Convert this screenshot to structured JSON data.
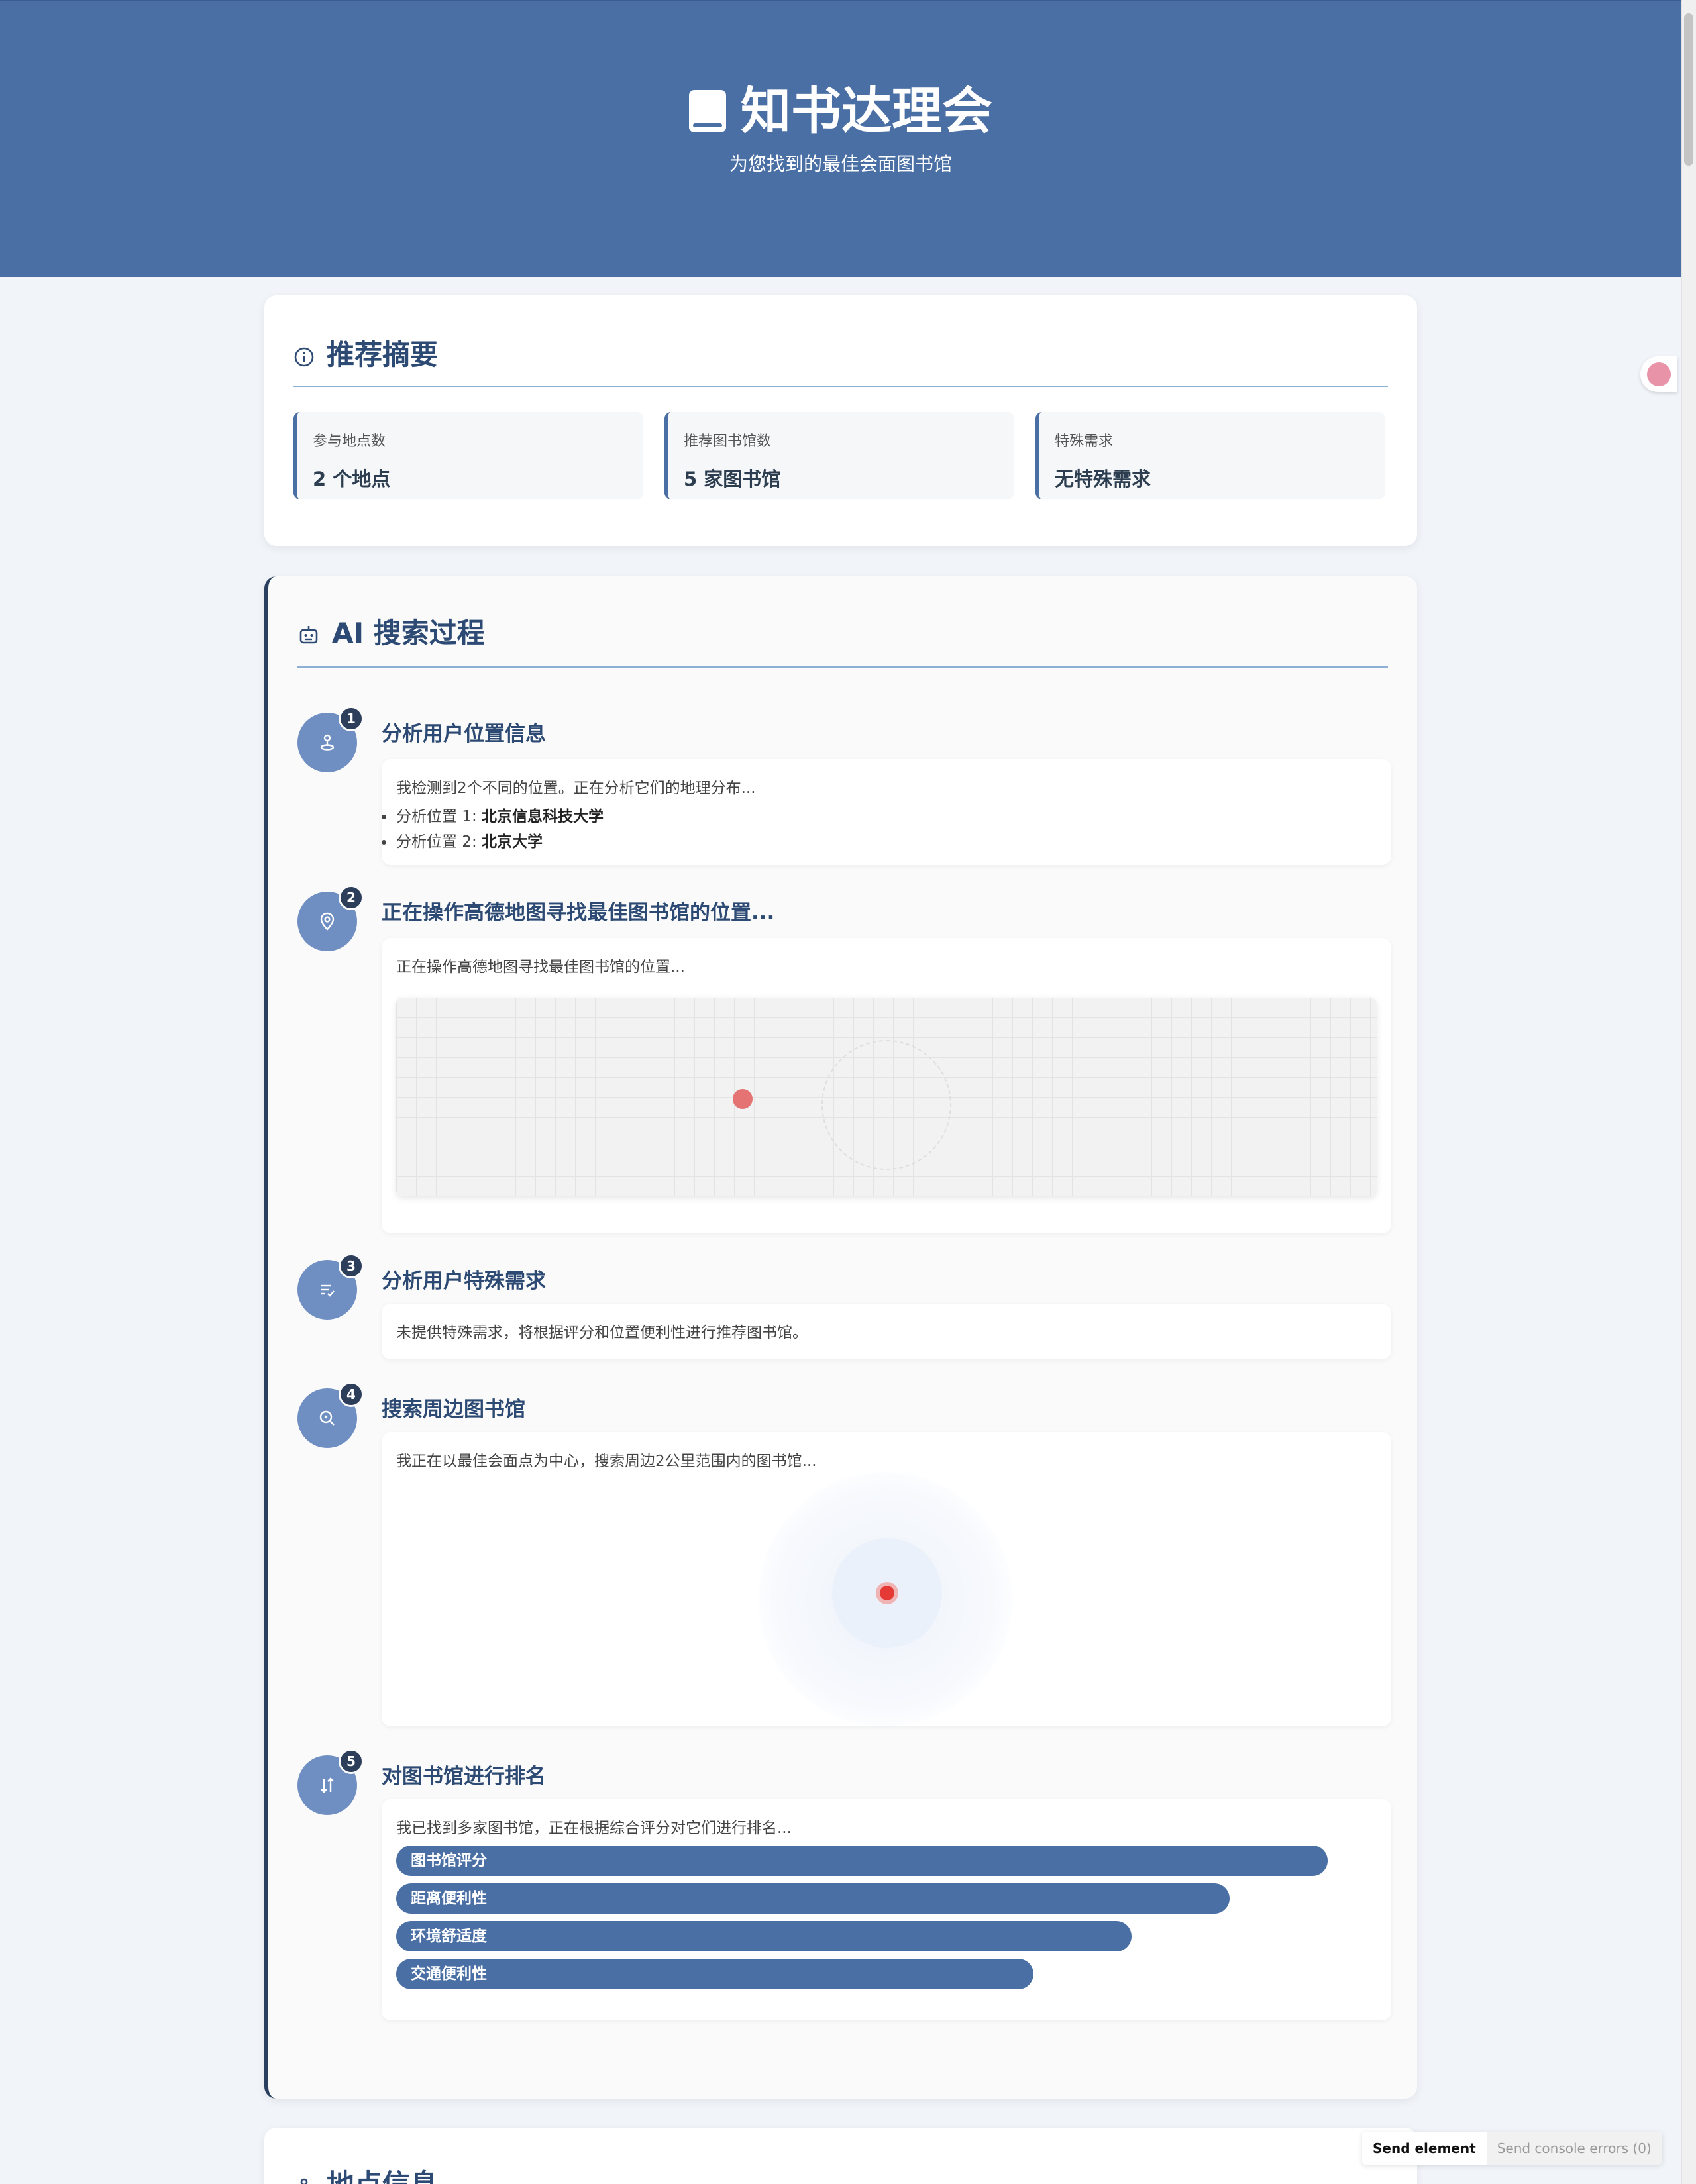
{
  "header": {
    "title": "知书达理会",
    "subtitle": "为您找到的最佳会面图书馆"
  },
  "summary": {
    "title": "推荐摘要",
    "stats": [
      {
        "label": "参与地点数",
        "value": "2 个地点"
      },
      {
        "label": "推荐图书馆数",
        "value": "5 家图书馆"
      },
      {
        "label": "特殊需求",
        "value": "无特殊需求"
      }
    ]
  },
  "ai": {
    "title": "AI 搜索过程",
    "steps": [
      {
        "num": "1",
        "title": "分析用户位置信息",
        "text": "我检测到2个不同的位置。正在分析它们的地理分布...",
        "items": [
          {
            "prefix": "分析位置 1: ",
            "name": "北京信息科技大学"
          },
          {
            "prefix": "分析位置 2: ",
            "name": "北京大学"
          }
        ]
      },
      {
        "num": "2",
        "title": "正在操作高德地图寻找最佳图书馆的位置...",
        "text": "正在操作高德地图寻找最佳图书馆的位置..."
      },
      {
        "num": "3",
        "title": "分析用户特殊需求",
        "text": "未提供特殊需求，将根据评分和位置便利性进行推荐图书馆。"
      },
      {
        "num": "4",
        "title": "搜索周边图书馆",
        "text": "我正在以最佳会面点为中心，搜索周边2公里范围内的图书馆..."
      },
      {
        "num": "5",
        "title": "对图书馆进行排名",
        "text": "我已找到多家图书馆，正在根据综合评分对它们进行排名...",
        "bars": [
          {
            "label": "图书馆评分",
            "fill": 0.95
          },
          {
            "label": "距离便利性",
            "fill": 0.85
          },
          {
            "label": "环境舒适度",
            "fill": 0.75
          },
          {
            "label": "交通便利性",
            "fill": 0.65
          }
        ]
      }
    ]
  },
  "location": {
    "title": "地点信息"
  },
  "devtools": {
    "send_element": "Send element",
    "send_errors": "Send console errors (0)"
  },
  "colors": {
    "primary": "#4a6fa5",
    "title": "#2c4a73",
    "step_circle": "#6f8fc2",
    "badge": "#2c3e5a",
    "marker": "#e53935"
  }
}
